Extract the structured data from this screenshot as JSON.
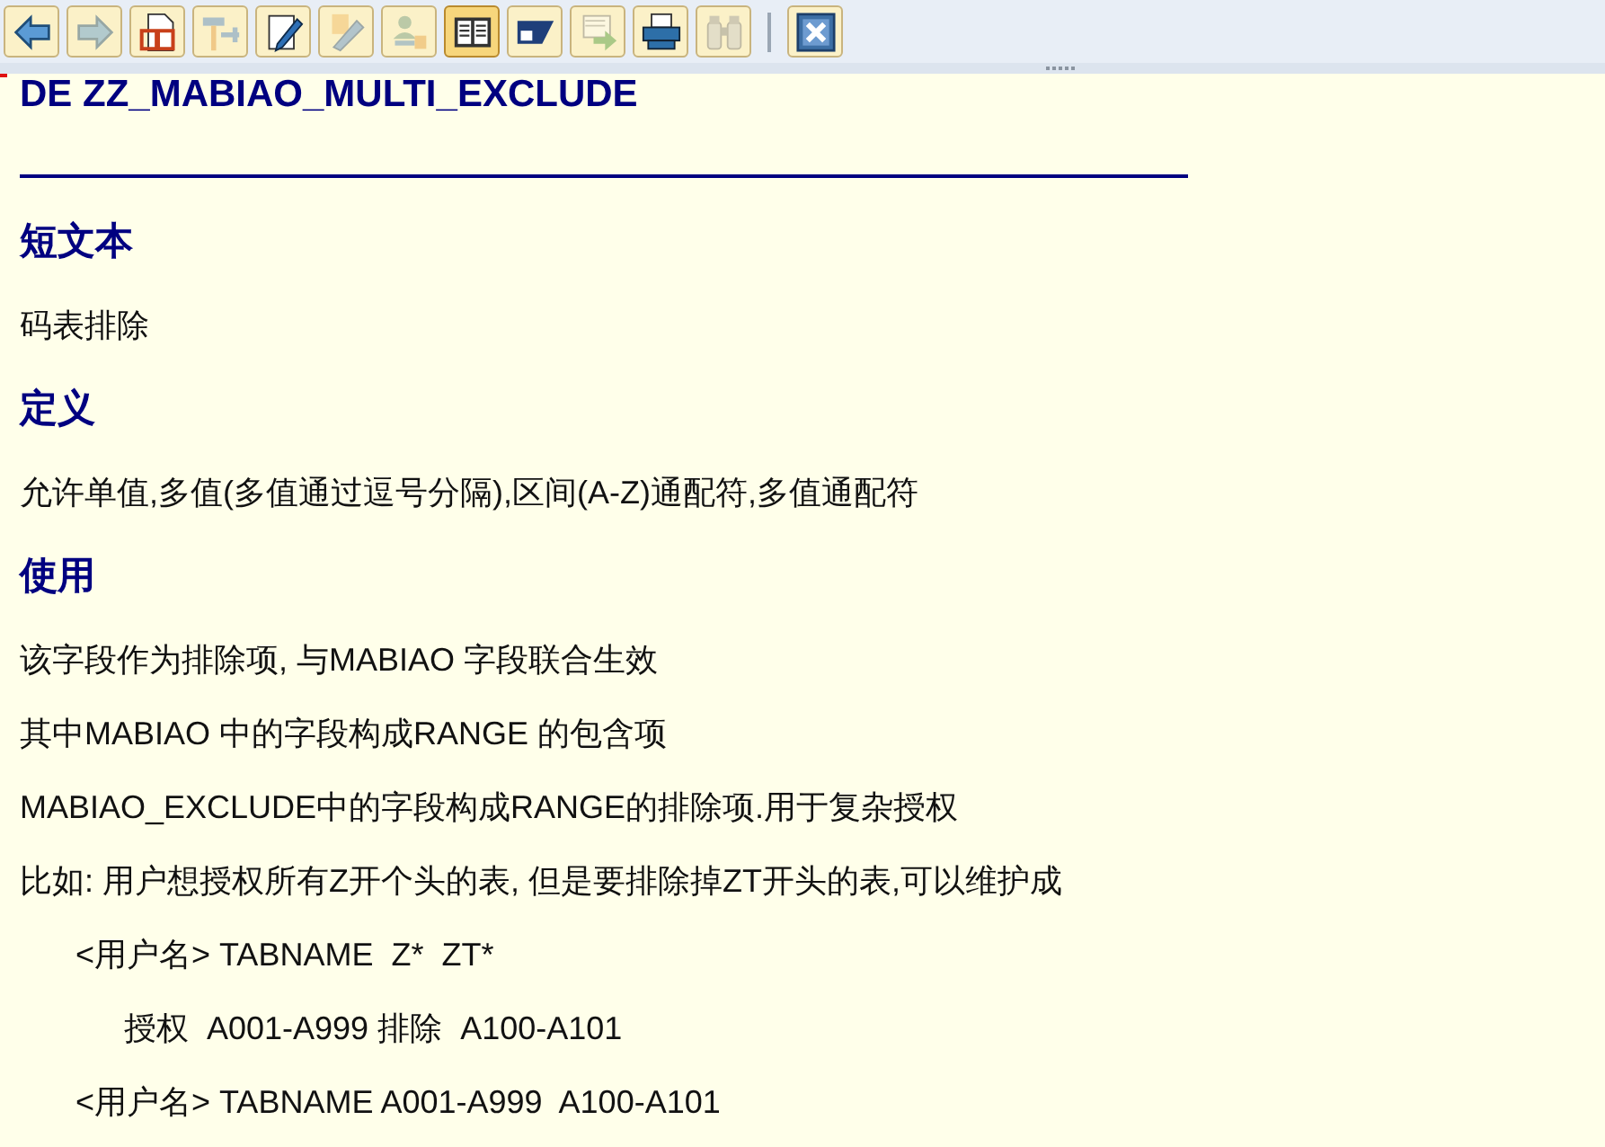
{
  "toolbar": {
    "groups": [
      {
        "buttons": [
          {
            "kind": "back",
            "disabled": false,
            "selected": false
          },
          {
            "kind": "forward",
            "disabled": true,
            "selected": false
          },
          {
            "kind": "display",
            "disabled": false,
            "selected": false
          },
          {
            "kind": "tools",
            "disabled": true,
            "selected": false
          },
          {
            "kind": "change",
            "disabled": false,
            "selected": false
          },
          {
            "kind": "edit",
            "disabled": true,
            "selected": false
          },
          {
            "kind": "user-key",
            "disabled": true,
            "selected": false
          },
          {
            "kind": "documentation",
            "disabled": false,
            "selected": true
          },
          {
            "kind": "layout",
            "disabled": false,
            "selected": false
          },
          {
            "kind": "transfer",
            "disabled": true,
            "selected": false
          },
          {
            "kind": "print",
            "disabled": false,
            "selected": false
          },
          {
            "kind": "find",
            "disabled": true,
            "selected": false
          }
        ]
      },
      {
        "buttons": [
          {
            "kind": "close",
            "disabled": false,
            "selected": false
          }
        ]
      }
    ]
  },
  "document": {
    "title": "DE ZZ_MABIAO_MULTI_EXCLUDE",
    "sections": [
      {
        "heading": "短文本",
        "paragraphs": [
          {
            "text": "码表排除"
          }
        ]
      },
      {
        "heading": "定义",
        "paragraphs": [
          {
            "text": "允许单值,多值(多值通过逗号分隔),区间(A-Z)通配符,多值通配符"
          }
        ]
      },
      {
        "heading": "使用",
        "paragraphs": [
          {
            "text": "该字段作为排除项, 与MABIAO 字段联合生效"
          },
          {
            "text": "其中MABIAO 中的字段构成RANGE 的包含项"
          },
          {
            "text": "MABIAO_EXCLUDE中的字段构成RANGE的排除项.用于复杂授权"
          },
          {
            "text": "比如: 用户想授权所有Z开个头的表, 但是要排除掉ZT开头的表,可以维护成",
            "children": [
              {
                "text": "<用户名> TABNAME  Z*  ZT*",
                "children": [
                  {
                    "text": "授权  A001-A999 排除  A100-A101"
                  }
                ]
              },
              {
                "text": "<用户名> TABNAME A001-A999  A100-A101"
              }
            ]
          }
        ]
      }
    ]
  }
}
